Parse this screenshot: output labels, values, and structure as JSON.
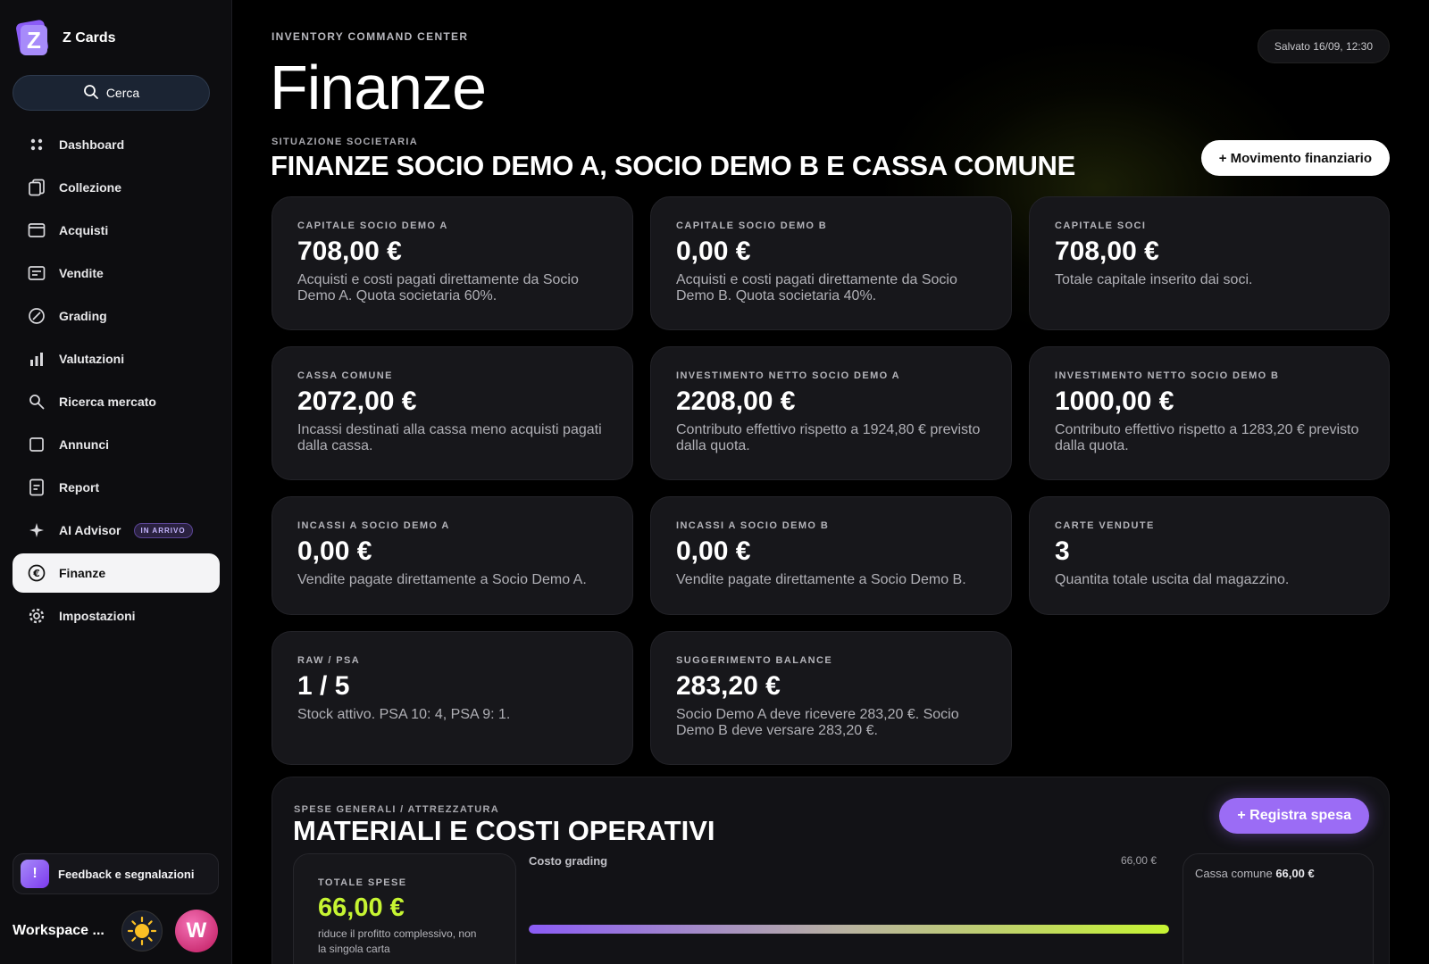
{
  "brand": {
    "name": "Z Cards",
    "logo_letter": "Z"
  },
  "search": {
    "label": "Cerca"
  },
  "nav": [
    {
      "label": "Dashboard",
      "icon": "dashboard-icon"
    },
    {
      "label": "Collezione",
      "icon": "cards-icon"
    },
    {
      "label": "Acquisti",
      "icon": "wallet-icon"
    },
    {
      "label": "Vendite",
      "icon": "receipt-icon"
    },
    {
      "label": "Grading",
      "icon": "grading-icon"
    },
    {
      "label": "Valutazioni",
      "icon": "bar-chart-icon"
    },
    {
      "label": "Ricerca mercato",
      "icon": "search-icon"
    },
    {
      "label": "Annunci",
      "icon": "square-icon"
    },
    {
      "label": "Report",
      "icon": "document-icon"
    },
    {
      "label": "AI Advisor",
      "icon": "sparkle-icon",
      "badge": "IN ARRIVO"
    },
    {
      "label": "Finanze",
      "icon": "euro-icon",
      "active": true
    },
    {
      "label": "Impostazioni",
      "icon": "gear-icon"
    }
  ],
  "feedback": {
    "label": "Feedback e segnalazioni",
    "icon_glyph": "!"
  },
  "workspace": {
    "label": "Workspace ...",
    "avatar_initial": "W"
  },
  "header": {
    "eyebrow": "INVENTORY COMMAND CENTER",
    "title": "Finanze",
    "saved": "Salvato 16/09, 12:30"
  },
  "section": {
    "eyebrow": "SITUAZIONE SOCIETARIA",
    "title": "FINANZE SOCIO DEMO A, SOCIO DEMO B E CASSA COMUNE",
    "button": "+ Movimento finanziario"
  },
  "cards": [
    {
      "label": "CAPITALE SOCIO DEMO A",
      "value": "708,00 €",
      "desc": "Acquisti e costi pagati direttamente da Socio Demo A. Quota societaria 60%."
    },
    {
      "label": "CAPITALE SOCIO DEMO B",
      "value": "0,00 €",
      "desc": "Acquisti e costi pagati direttamente da Socio Demo B. Quota societaria 40%."
    },
    {
      "label": "CAPITALE SOCI",
      "value": "708,00 €",
      "desc": "Totale capitale inserito dai soci."
    },
    {
      "label": "CASSA COMUNE",
      "value": "2072,00 €",
      "desc": "Incassi destinati alla cassa meno acquisti pagati dalla cassa."
    },
    {
      "label": "INVESTIMENTO NETTO SOCIO DEMO A",
      "value": "2208,00 €",
      "desc": "Contributo effettivo rispetto a 1924,80 € previsto dalla quota."
    },
    {
      "label": "INVESTIMENTO NETTO SOCIO DEMO B",
      "value": "1000,00 €",
      "desc": "Contributo effettivo rispetto a 1283,20 € previsto dalla quota."
    },
    {
      "label": "INCASSI A SOCIO DEMO A",
      "value": "0,00 €",
      "desc": "Vendite pagate direttamente a Socio Demo A."
    },
    {
      "label": "INCASSI A SOCIO DEMO B",
      "value": "0,00 €",
      "desc": "Vendite pagate direttamente a Socio Demo B."
    },
    {
      "label": "CARTE VENDUTE",
      "value": "3",
      "desc": "Quantita totale uscita dal magazzino."
    },
    {
      "label": "RAW / PSA",
      "value": "1 / 5",
      "desc": "Stock attivo. PSA 10: 4, PSA 9: 1."
    },
    {
      "label": "SUGGERIMENTO BALANCE",
      "value": "283,20 €",
      "desc": "Socio Demo A deve ricevere 283,20 €. Socio Demo B deve versare 283,20 €."
    }
  ],
  "ops": {
    "eyebrow": "SPESE GENERALI / ATTREZZATURA",
    "title": "MATERIALI E COSTI OPERATIVI",
    "button": "+ Registra spesa",
    "total_label": "TOTALE SPESE",
    "total_value": "66,00 €",
    "total_desc": "riduce il profitto complessivo, non la singola carta",
    "bar_label": "Costo grading",
    "bar_amount": "66,00 €",
    "bar_fraction": 1.0,
    "cassa_label": "Cassa comune",
    "cassa_value": "66,00 €"
  },
  "colors": {
    "accent_purple": "#9b6cf5",
    "accent_lime": "#c6f432",
    "active_nav_bg": "#f4f4f6"
  }
}
